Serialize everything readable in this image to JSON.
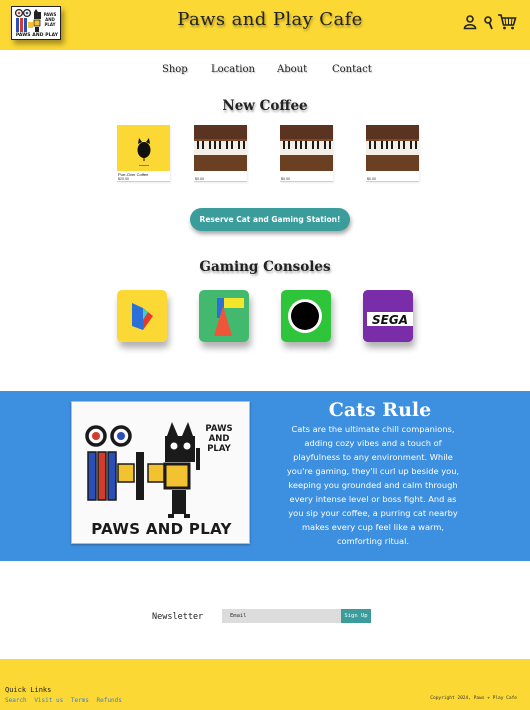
{
  "header": {
    "logo_text": "PAWS AND PLAY",
    "site_title": "Paws and Play Cafe",
    "icons": [
      "user-icon",
      "search-icon",
      "cart-icon"
    ]
  },
  "nav": {
    "items": [
      {
        "label": "Shop"
      },
      {
        "label": "Location"
      },
      {
        "label": "About"
      },
      {
        "label": "Contact"
      }
    ]
  },
  "new_coffee": {
    "heading": "New Coffee",
    "products": [
      {
        "name": "Purr-Over Coffee",
        "price": "$20.00",
        "image": "black-cat-on-yellow"
      },
      {
        "name": "",
        "price": "$0.00",
        "image": "piano-keys"
      },
      {
        "name": "",
        "price": "$0.00",
        "image": "piano-keys"
      },
      {
        "name": "",
        "price": "$0.00",
        "image": "piano-keys"
      }
    ]
  },
  "cta": {
    "label": "Reserve Cat and Gaming Station!",
    "color": "#3b9c9c"
  },
  "consoles": {
    "heading": "Gaming Consoles",
    "items": [
      {
        "icon": "blue-play-icon",
        "bg": "#fbd834"
      },
      {
        "icon": "triangle-shapes-icon",
        "bg": "#43b96f"
      },
      {
        "icon": "black-circle-icon",
        "bg": "#2ec53b"
      },
      {
        "label": "SEGA",
        "icon": "sega-logo-icon",
        "bg": "#7a2da8"
      }
    ]
  },
  "cats": {
    "image_text": "PAWS AND PLAY",
    "image_small_text": "PAWS AND PLAY",
    "title": "Cats Rule",
    "body": "Cats are the ultimate chill companions, adding cozy vibes and a touch of playfulness to any environment. While you're gaming, they'll curl up beside you, keeping you grounded and calm through every intense level or boss fight. And as you sip your coffee, a purring cat nearby makes every cup feel like a warm, comforting ritual.",
    "bg": "#3d8fe0"
  },
  "newsletter": {
    "label": "Newsletter",
    "placeholder": "Email",
    "button_label": "Sign Up"
  },
  "footer": {
    "quick_links_title": "Quick Links",
    "links": [
      "Search",
      "Visit us",
      "Terms",
      "Refunds"
    ],
    "copyright": "Copyright 2024, Paws + Play Cafe",
    "bg": "#fbd834"
  }
}
